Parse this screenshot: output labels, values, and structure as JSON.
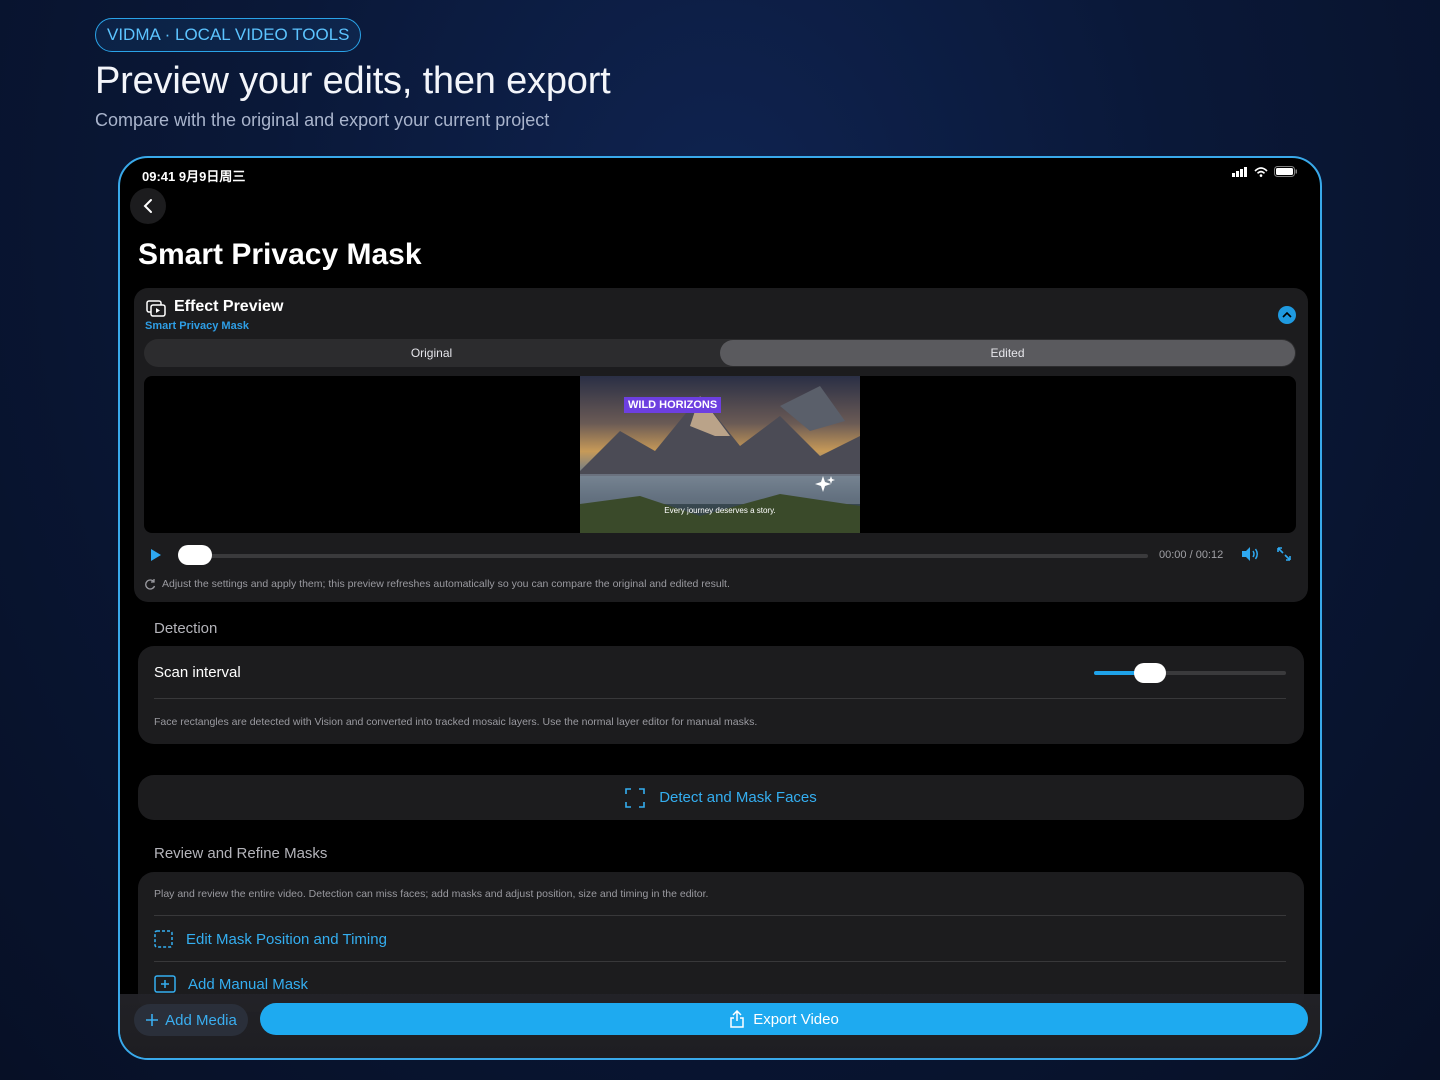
{
  "hero": {
    "tag": "VIDMA · LOCAL VIDEO TOOLS",
    "title": "Preview your edits, then export",
    "subtitle": "Compare with the original and export your current project"
  },
  "status": {
    "time": "09:41  9月9日周三"
  },
  "page": {
    "title": "Smart Privacy Mask"
  },
  "preview": {
    "title": "Effect Preview",
    "subtitle": "Smart Privacy Mask",
    "segments": [
      "Original",
      "Edited"
    ],
    "selected_segment": "Edited",
    "video_tag": "WILD HORIZONS",
    "video_caption": "Every journey deserves a story.",
    "time": "00:00 / 00:12",
    "progress": 0,
    "hint": "Adjust the settings and apply them; this preview refreshes automatically so you can compare the original and edited result."
  },
  "detection": {
    "section": "Detection",
    "scan_label": "Scan interval",
    "scan_value_fraction": 0.29,
    "note": "Face rectangles are detected with Vision and converted into tracked mosaic layers. Use the normal layer editor for manual masks."
  },
  "detect_button": {
    "label": "Detect and Mask Faces"
  },
  "review": {
    "section": "Review and Refine Masks",
    "note": "Play and review the entire video. Detection can miss faces; add masks and adjust position, size and timing in the editor.",
    "edit_label": "Edit Mask Position and Timing",
    "add_label": "Add Manual Mask"
  },
  "bottom": {
    "add_media": "Add Media",
    "export": "Export Video"
  },
  "colors": {
    "accent": "#1eaaf0",
    "tag_purple": "#6d3fe0",
    "frame": "#39a9ea"
  }
}
